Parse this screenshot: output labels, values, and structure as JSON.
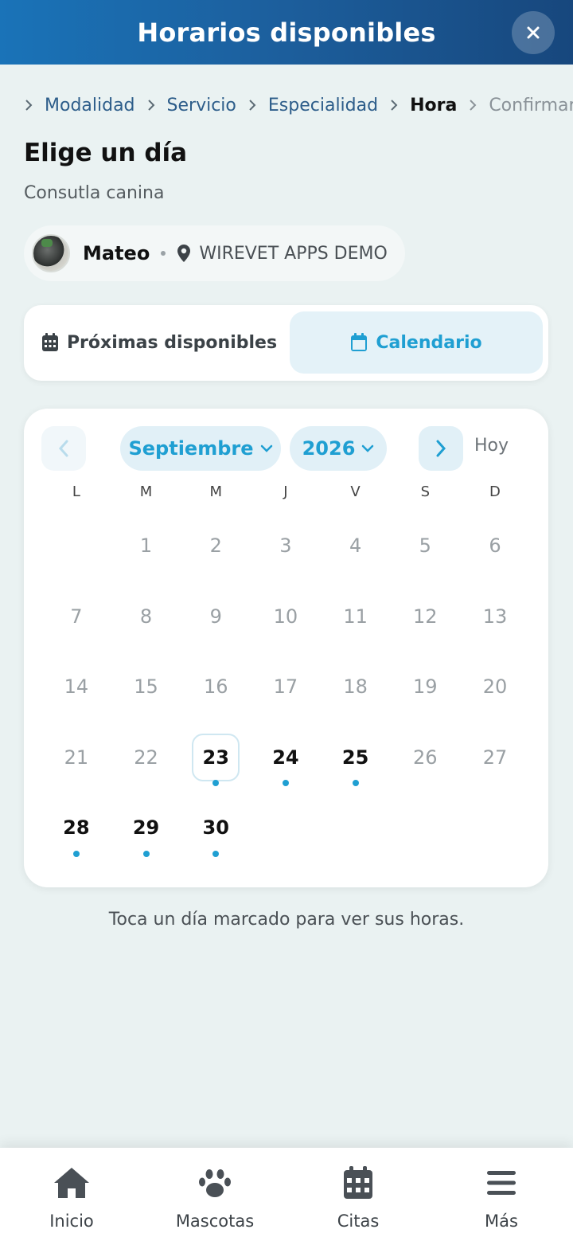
{
  "header": {
    "title": "Horarios disponibles",
    "close_icon": "×"
  },
  "breadcrumb": {
    "items": [
      {
        "label": "Modalidad",
        "state": "done"
      },
      {
        "label": "Servicio",
        "state": "done"
      },
      {
        "label": "Especialidad",
        "state": "done"
      },
      {
        "label": "Hora",
        "state": "current"
      },
      {
        "label": "Confirmar",
        "state": "pending"
      }
    ]
  },
  "page": {
    "title": "Elige un día",
    "subtitle": "Consutla canina"
  },
  "pet": {
    "name": "Mateo",
    "clinic": "WIREVET APPS DEMO"
  },
  "tabs": {
    "next_available": "Próximas disponibles",
    "calendar": "Calendario",
    "active": "calendar"
  },
  "calendar": {
    "month": "Septiembre",
    "year": "2026",
    "today_label": "Hoy",
    "weekdays": [
      "L",
      "M",
      "M",
      "J",
      "V",
      "S",
      "D"
    ],
    "leading_blank_days": 1,
    "days_in_month": 30,
    "today": 23,
    "available_days": [
      23,
      24,
      25,
      28,
      29,
      30
    ]
  },
  "hint": "Toca un día marcado para ver sus horas.",
  "bottom_nav": {
    "items": [
      {
        "label": "Inicio",
        "icon": "home-icon"
      },
      {
        "label": "Mascotas",
        "icon": "paw-icon"
      },
      {
        "label": "Citas",
        "icon": "calendar-icon"
      },
      {
        "label": "Más",
        "icon": "menu-icon"
      }
    ]
  },
  "colors": {
    "accent": "#1f9fd2",
    "header_start": "#1a73b8",
    "header_end": "#17477d",
    "background": "#eaf2f2"
  }
}
